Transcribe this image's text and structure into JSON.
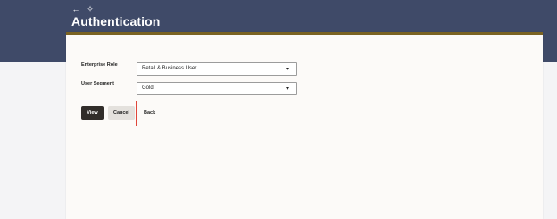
{
  "header": {
    "title": "Authentication",
    "back_icon": "←",
    "pin_icon": "✧",
    "bg_color": "#3f4a68"
  },
  "form": {
    "enterprise_role": {
      "label": "Enterprise Role",
      "value": "Retail & Business User"
    },
    "user_segment": {
      "label": "User Segment",
      "value": "Gold"
    }
  },
  "actions": {
    "view_label": "View",
    "cancel_label": "Cancel",
    "back_label": "Back",
    "highlight_color": "#e0463a"
  }
}
